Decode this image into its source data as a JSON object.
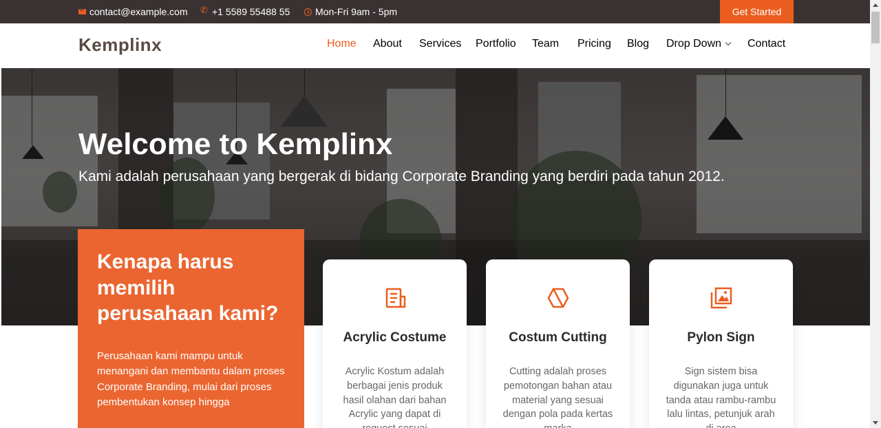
{
  "topbar": {
    "email": "contact@example.com",
    "phone": "+1 5589 55488 55",
    "hours": "Mon-Fri 9am - 5pm",
    "cta": "Get Started"
  },
  "header": {
    "logo": "Kemplinx",
    "nav": [
      "Home",
      "About",
      "Services",
      "Portfolio",
      "Team",
      "Pricing",
      "Blog",
      "Drop Down",
      "Contact"
    ],
    "active": "Home"
  },
  "hero": {
    "title": "Welcome to Kemplinx",
    "subtitle": "Kami adalah perusahaan yang bergerak di bidang Corporate Branding yang berdiri pada tahun 2012."
  },
  "why": {
    "title": "Kenapa harus memilih perusahaan kami?",
    "text": "Perusahaan kami mampu untuk menangani dan membantu dalam proses Corporate Branding, mulai dari proses pembentukan konsep hingga"
  },
  "cards": [
    {
      "icon": "receipt-icon",
      "title": "Acrylic Costume",
      "text": "Acrylic Kostum adalah berbagai jenis produk hasil olahan dari bahan Acrylic yang dapat di request sesuai"
    },
    {
      "icon": "cube-icon",
      "title": "Costum Cutting",
      "text": "Cutting adalah proses pemotongan bahan atau material yang sesuai dengan pola pada kertas marka"
    },
    {
      "icon": "images-icon",
      "title": "Pylon Sign",
      "text": "Sign sistem bisa digunakan juga untuk tanda atau rambu-rambu lalu lintas, petunjuk arah di area"
    }
  ],
  "colors": {
    "accent": "#eb5d1e",
    "topbar": "#3a3232"
  }
}
